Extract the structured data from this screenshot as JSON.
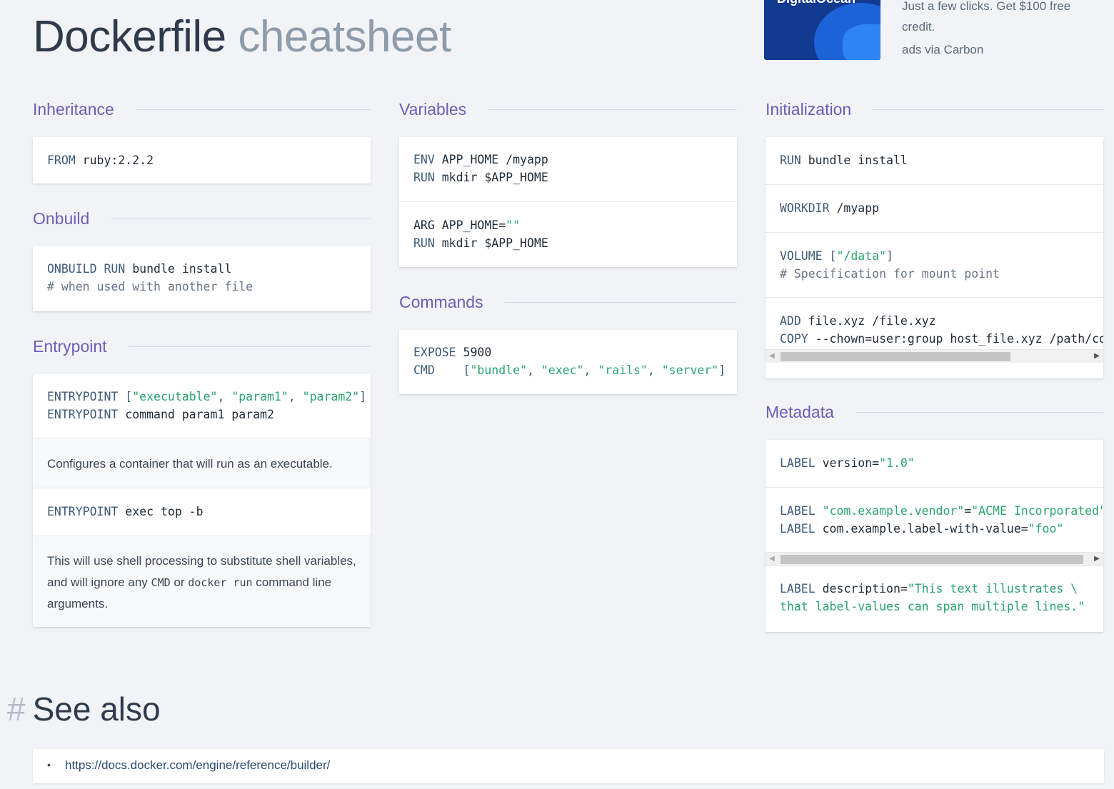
{
  "header": {
    "title_main": "Dockerfile",
    "title_sub": "cheatsheet"
  },
  "ad": {
    "brand": "DigitalOcean",
    "text": "Just a few clicks. Get $100 free credit.",
    "via": "ads via Carbon"
  },
  "sections": {
    "inheritance": {
      "title": "Inheritance"
    },
    "onbuild": {
      "title": "Onbuild"
    },
    "entrypoint": {
      "title": "Entrypoint",
      "desc1": "Configures a container that will run as an executable.",
      "desc2_a": "This will use shell processing to substitute shell variables, and will ignore any",
      "desc2_code1": "CMD",
      "desc2_b": "or",
      "desc2_code2": "docker run",
      "desc2_c": "command line arguments."
    },
    "variables": {
      "title": "Variables"
    },
    "commands": {
      "title": "Commands"
    },
    "initialization": {
      "title": "Initialization"
    },
    "metadata": {
      "title": "Metadata"
    }
  },
  "code": {
    "inherit_from_kw": "FROM",
    "inherit_from_val": " ruby:2.2.2",
    "onbuild_kw1": "ONBUILD",
    "onbuild_kw2": "RUN",
    "onbuild_val": " bundle install",
    "onbuild_comment": "# when used with another file",
    "ep1_kw": "ENTRYPOINT",
    "ep1_open": " [",
    "ep1_s1": "\"executable\"",
    "ep1_c1": ", ",
    "ep1_s2": "\"param1\"",
    "ep1_c2": ", ",
    "ep1_s3": "\"param2\"",
    "ep1_close": "]",
    "ep2_kw": "ENTRYPOINT",
    "ep2_val": " command param1 param2",
    "ep3_kw": "ENTRYPOINT",
    "ep3_val": " exec top -b",
    "var1_kw": "ENV",
    "var1_val": " APP_HOME /myapp",
    "var2_kw": "RUN",
    "var2_val": " mkdir $APP_HOME",
    "var3_kw": "ARG",
    "var3_val": " APP_HOME=",
    "var3_str": "\"\"",
    "var4_kw": "RUN",
    "var4_val": " mkdir $APP_HOME",
    "cmd1_kw": "EXPOSE",
    "cmd1_val": " 5900",
    "cmd2_kw": "CMD",
    "cmd2_pad": "    [",
    "cmd2_s1": "\"bundle\"",
    "cmd2_c1": ", ",
    "cmd2_s2": "\"exec\"",
    "cmd2_c2": ", ",
    "cmd2_s3": "\"rails\"",
    "cmd2_c3": ", ",
    "cmd2_s4": "\"server\"",
    "cmd2_close": "]",
    "init1_kw": "RUN",
    "init1_val": " bundle install",
    "init2_kw": "WORKDIR",
    "init2_val": " /myapp",
    "init3_kw": "VOLUME",
    "init3_open": " [",
    "init3_str": "\"/data\"",
    "init3_close": "]",
    "init3_comment": "# Specification for mount point",
    "init4_kw": "ADD",
    "init4_val": " file.xyz /file.xyz",
    "init5_kw": "COPY",
    "init5_val": " --chown=user:group host_file.xyz /path/container_file.xyz",
    "meta1_kw": "LABEL",
    "meta1_val": " version=",
    "meta1_str": "\"1.0\"",
    "meta2_kw": "LABEL",
    "meta2_str1": " \"com.example.vendor\"",
    "meta2_eq": "=",
    "meta2_str2": "\"ACME Incorporated\"",
    "meta3_kw": "LABEL",
    "meta3_val": " com.example.label-with-value=",
    "meta3_str": "\"foo\"",
    "meta4_kw": "LABEL",
    "meta4_val": " description=",
    "meta4_str1": "\"This text illustrates \\",
    "meta4_str2": "that label-values can span multiple lines.\""
  },
  "see_also": {
    "hash": "#",
    "title": "See also",
    "link": "https://docs.docker.com/engine/reference/builder/",
    "bullet": "•"
  }
}
